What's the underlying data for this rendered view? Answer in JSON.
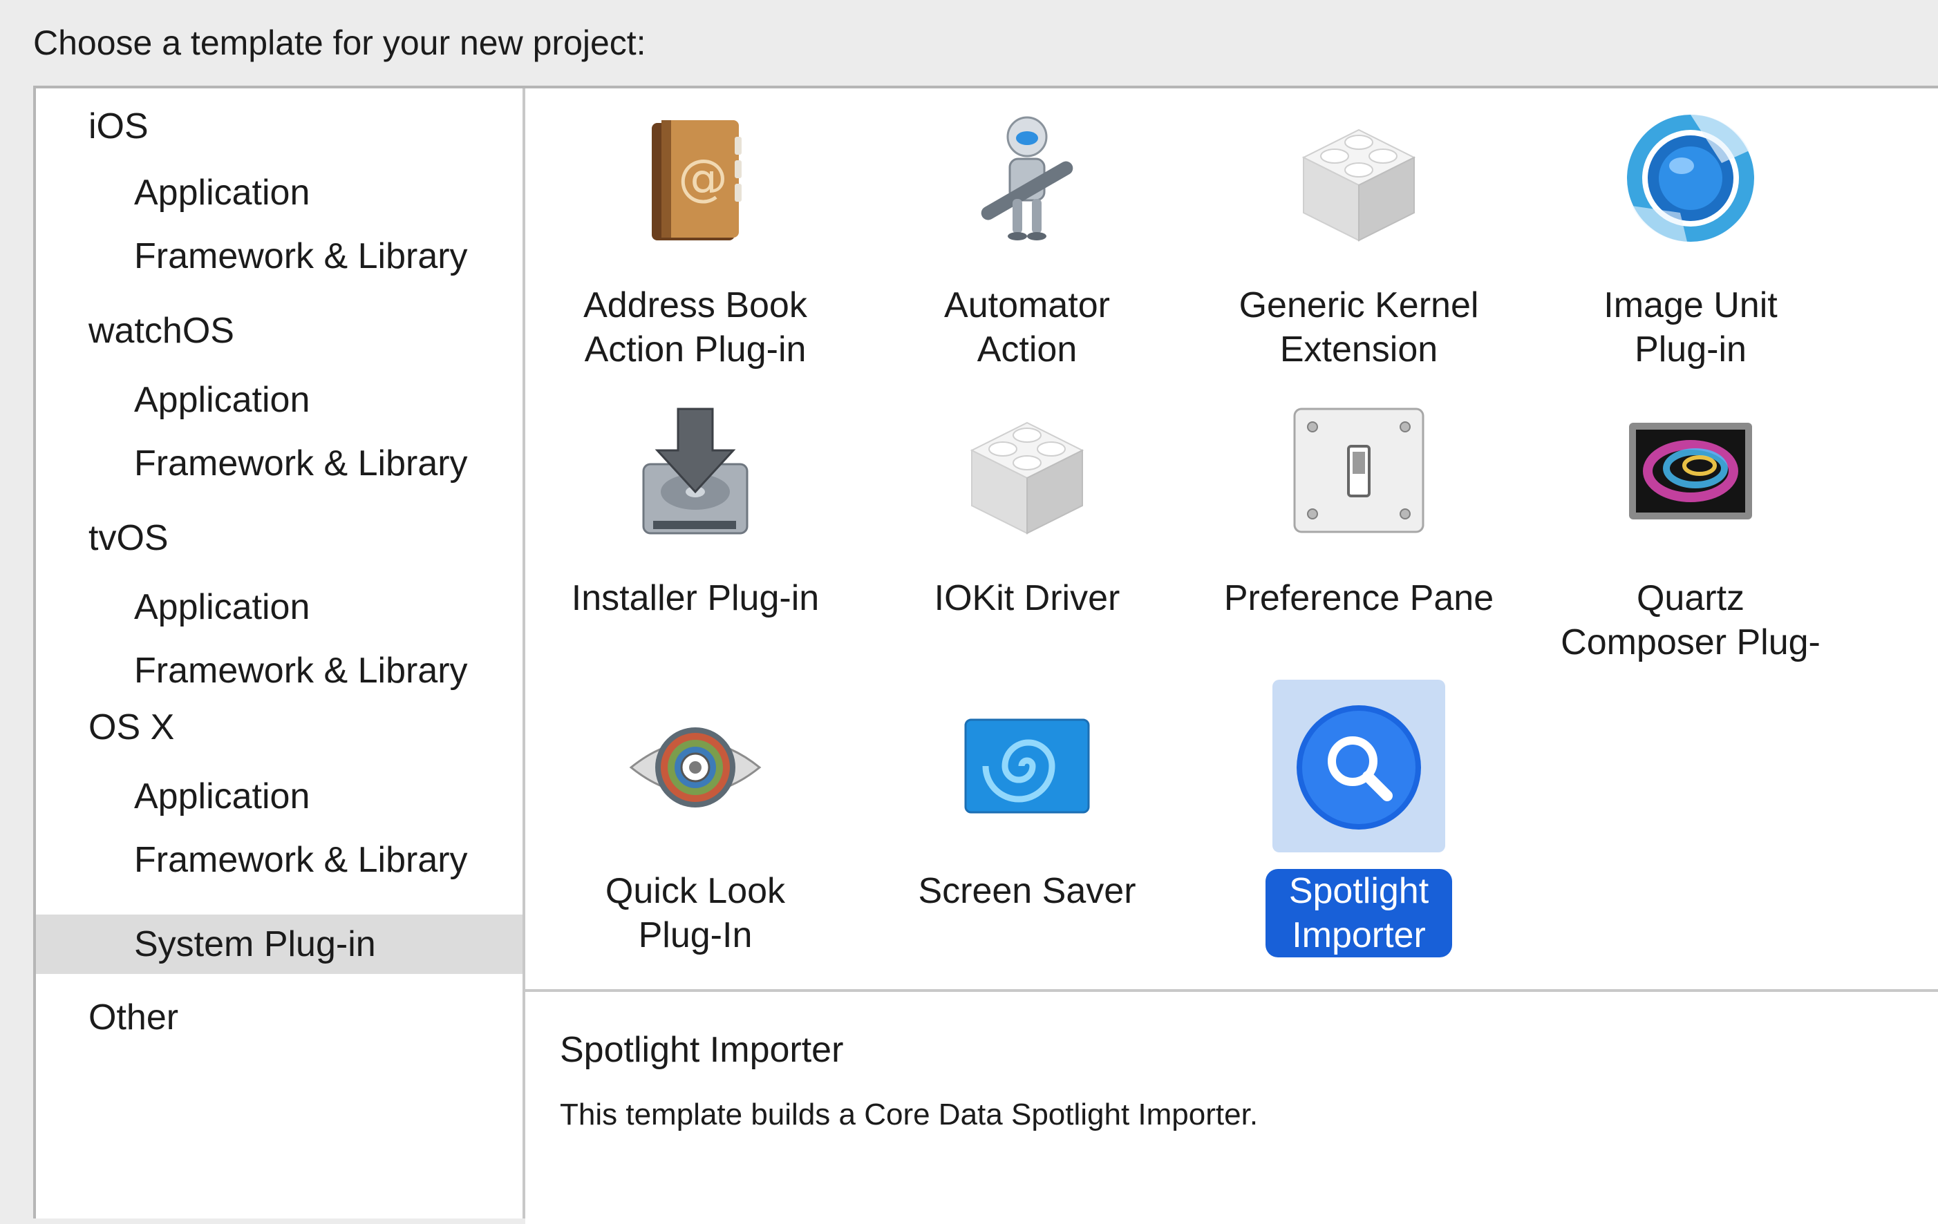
{
  "header": {
    "title": "Choose a template for your new project:"
  },
  "sidebar": {
    "groups": [
      {
        "label": "iOS",
        "items": [
          "Application",
          "Framework & Library"
        ]
      },
      {
        "label": "watchOS",
        "items": [
          "Application",
          "Framework & Library"
        ]
      },
      {
        "label": "tvOS",
        "items": [
          "Application",
          "Framework & Library"
        ]
      },
      {
        "label": "OS X",
        "items": [
          "Application",
          "Framework & Library",
          "System Plug-in"
        ]
      },
      {
        "label": "Other",
        "items": []
      }
    ],
    "selected": "OS X / System Plug-in"
  },
  "templates": [
    {
      "line1": "Address Book",
      "line2": "Action Plug-in",
      "icon": "address-book-icon"
    },
    {
      "line1": "Automator",
      "line2": "Action",
      "icon": "automator-robot-icon"
    },
    {
      "line1": "Generic Kernel",
      "line2": "Extension",
      "icon": "lego-brick-icon"
    },
    {
      "line1": "Image Unit",
      "line2": "Plug-in",
      "icon": "image-unit-aperture-icon"
    },
    {
      "line1": "Installer Plug-in",
      "line2": "",
      "icon": "installer-disk-icon"
    },
    {
      "line1": "IOKit Driver",
      "line2": "",
      "icon": "lego-brick-icon"
    },
    {
      "line1": "Preference Pane",
      "line2": "",
      "icon": "light-switch-icon"
    },
    {
      "line1": "Quartz",
      "line2": "Composer Plug-",
      "icon": "quartz-composer-icon"
    },
    {
      "line1": "Quick Look",
      "line2": "Plug-In",
      "icon": "quick-look-eye-icon"
    },
    {
      "line1": "Screen Saver",
      "line2": "",
      "icon": "screen-saver-swirl-icon"
    },
    {
      "line1": "Spotlight",
      "line2": "Importer",
      "icon": "spotlight-magnifier-icon"
    }
  ],
  "selected_template": "Spotlight Importer",
  "description": {
    "title": "Spotlight Importer",
    "text": "This template builds a Core Data Spotlight Importer."
  },
  "colors": {
    "selection_blue": "#1860d8",
    "selection_icon_bg": "#c9dcf5",
    "sidebar_selected": "#dcdcdc"
  }
}
